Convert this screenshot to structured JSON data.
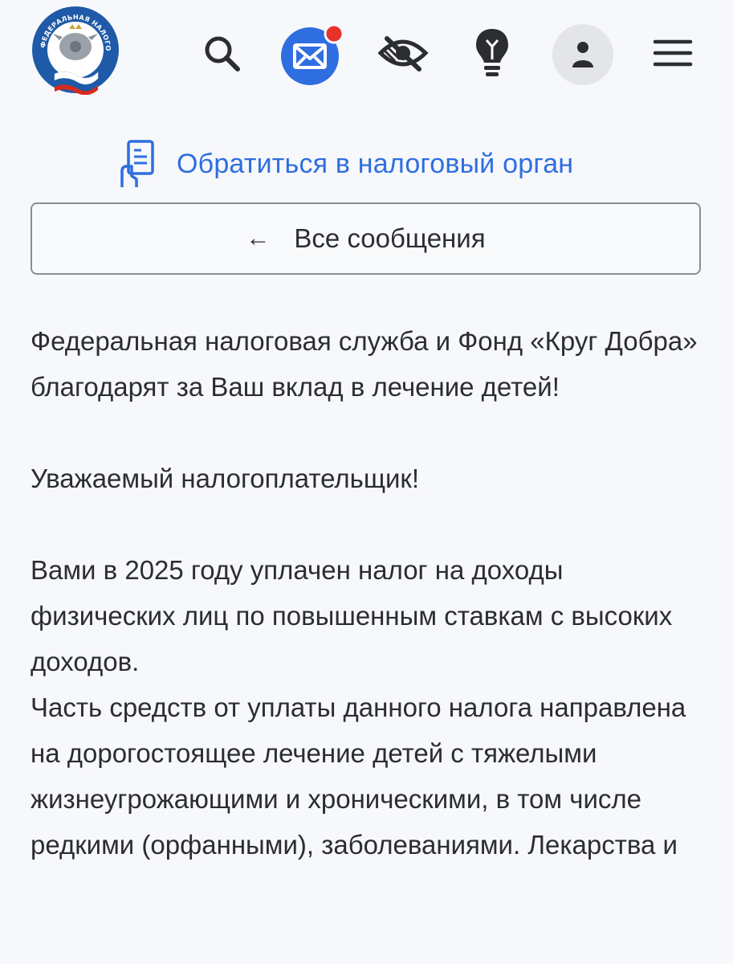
{
  "header": {
    "logo": {
      "name": "fns-emblem-logo",
      "text": "ФЕДЕРАЛЬНАЯ НАЛОГОВАЯ СЛУЖБА"
    },
    "icons": [
      "search-icon",
      "mail-icon",
      "eye-off-icon",
      "lightbulb-icon",
      "user-icon",
      "menu-icon"
    ]
  },
  "contact_link": {
    "label": "Обратиться в налоговый орган",
    "icon": "document-hand-icon"
  },
  "back_button": {
    "arrow": "←",
    "label": "Все сообщения"
  },
  "message": {
    "title": "Федеральная налоговая служба и Фонд «Круг Добра» благодарят за Ваш вклад в лечение детей!",
    "greeting": "Уважаемый налогоплательщик!",
    "paragraph1": "Вами в 2025 году уплачен налог на доходы физических лиц по повышенным ставкам с высоких доходов.",
    "paragraph2": "Часть средств от уплаты данного налога направлена на дорогостоящее лечение детей с тяжелыми жизнеугрожающими и хроническими, в том числе редкими (орфанными), заболеваниями. Лекарства и"
  },
  "colors": {
    "accent": "#2f6ee0",
    "mail_badge": "#e5332a",
    "background": "#f7f8fb",
    "text": "#2b2d33"
  }
}
